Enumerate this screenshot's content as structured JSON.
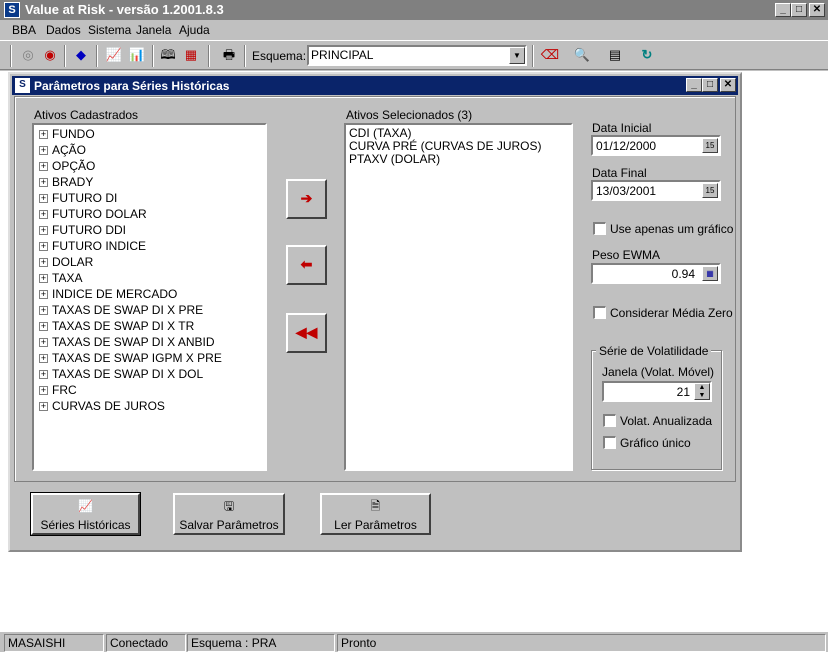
{
  "app": {
    "title": "Value at Risk - versão 1.2001.8.3",
    "icon": "app-logo-icon"
  },
  "menu": [
    "BBA",
    "Dados",
    "Sistema",
    "Janela",
    "Ajuda"
  ],
  "toolbar": {
    "schema_label": "Esquema:",
    "schema_value": "PRINCIPAL",
    "icons": [
      "disc-icon",
      "target-icon",
      "diamond-icon",
      "chart-icon",
      "chart-alt-icon",
      "book-icon",
      "grid-chart-icon",
      "printer-icon",
      "eraser-icon",
      "find-icon",
      "calculator-icon",
      "refresh-icon"
    ]
  },
  "dialog": {
    "title": "Parâmetros para Séries Históricas",
    "available_label": "Ativos Cadastrados",
    "available_items": [
      "FUNDO",
      "AÇÃO",
      "OPÇÃO",
      "BRADY",
      "FUTURO DI",
      "FUTURO DOLAR",
      "FUTURO DDI",
      "FUTURO INDICE",
      "DOLAR",
      "TAXA",
      "INDICE DE MERCADO",
      "TAXAS DE SWAP DI X PRE",
      "TAXAS DE SWAP DI X TR",
      "TAXAS DE SWAP DI X ANBID",
      "TAXAS DE SWAP IGPM X PRE",
      "TAXAS DE SWAP DI X DOL",
      "FRC",
      "CURVAS DE JUROS"
    ],
    "selected_label": "Ativos Selecionados (3)",
    "selected_items": [
      "CDI (TAXA)",
      "CURVA PRÉ (CURVAS DE JUROS)",
      "PTAXV (DOLAR)"
    ],
    "date_start_label": "Data Inicial",
    "date_start": "01/12/2000",
    "date_end_label": "Data Final",
    "date_end": "13/03/2001",
    "calendar_icon_text": "15",
    "single_chart_label": "Use apenas um gráfico",
    "ewma_label": "Peso EWMA",
    "ewma_value": "0.94",
    "zero_mean_label": "Considerar Média Zero",
    "vol_group_title": "Série de Volatilidade",
    "window_label": "Janela (Volat. Móvel)",
    "window_value": "21",
    "annualized_label": "Volat. Anualizada",
    "single_graph_label": "Gráfico único",
    "btn_series": "Séries Históricas",
    "btn_save": "Salvar Parâmetros",
    "btn_load": "Ler Parâmetros"
  },
  "status": [
    "MASAISHI",
    "Conectado",
    "Esquema : PRA",
    "Pronto"
  ]
}
